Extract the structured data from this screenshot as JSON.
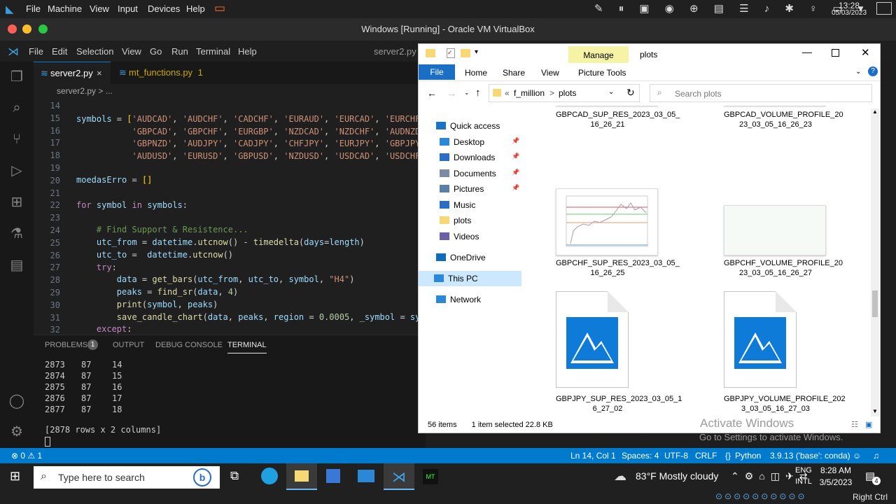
{
  "host": {
    "menu": [
      "File",
      "Machine",
      "View",
      "Input",
      "Devices",
      "Help"
    ],
    "time": "13:28",
    "date": "05/03/2023",
    "title": "Windows [Running] - Oracle VM VirtualBox",
    "right_ctrl": "Right Ctrl"
  },
  "vscode": {
    "menu": [
      "File",
      "Edit",
      "Selection",
      "View",
      "Go",
      "Run",
      "Terminal",
      "Help"
    ],
    "window_title": "server2.py -",
    "tabs": [
      {
        "label": "server2.py",
        "active": true,
        "close": "×"
      },
      {
        "label": "mt_functions.py",
        "badge": "1",
        "active": false
      }
    ],
    "breadcrumb": "server2.py > ...",
    "line_numbers": [
      "14",
      "15",
      "16",
      "17",
      "18",
      "19",
      "20",
      "21",
      "22",
      "23",
      "24",
      "25",
      "26",
      "27",
      "28",
      "29",
      "30",
      "31",
      "32"
    ],
    "panel_tabs": [
      "PROBLEMS",
      "OUTPUT",
      "DEBUG CONSOLE",
      "TERMINAL"
    ],
    "problems_badge": "1",
    "terminal_rows": [
      [
        "2873",
        "87",
        "14"
      ],
      [
        "2874",
        "87",
        "15"
      ],
      [
        "2875",
        "87",
        "16"
      ],
      [
        "2876",
        "87",
        "17"
      ],
      [
        "2877",
        "87",
        "18"
      ]
    ],
    "terminal_summary": "[2878 rows x 2 columns]",
    "status": {
      "errors": "⊗ 0 ⚠ 1",
      "position": "Ln 14, Col 1",
      "spaces": "Spaces: 4",
      "encoding": "UTF-8",
      "eol": "CRLF",
      "language": "Python",
      "interpreter": "3.9.13 ('base': conda)"
    }
  },
  "explorer": {
    "title": "plots",
    "manage": "Manage",
    "ribbon": [
      "File",
      "Home",
      "Share",
      "View",
      "Picture Tools"
    ],
    "address": [
      "«",
      "f_million",
      ">",
      "plots"
    ],
    "search_placeholder": "Search plots",
    "nav": [
      {
        "label": "Quick access",
        "icon": "star-icon",
        "color": "#1a73c7"
      },
      {
        "label": "Desktop",
        "icon": "desktop-icon",
        "color": "#2b88d8",
        "pinned": true
      },
      {
        "label": "Downloads",
        "icon": "download-icon",
        "color": "#2b6cc4",
        "pinned": true
      },
      {
        "label": "Documents",
        "icon": "document-icon",
        "color": "#7a8ba3",
        "pinned": true
      },
      {
        "label": "Pictures",
        "icon": "pictures-icon",
        "color": "#5b7fa6",
        "pinned": true
      },
      {
        "label": "Music",
        "icon": "music-icon",
        "color": "#2b6cc4"
      },
      {
        "label": "plots",
        "icon": "folder-icon",
        "color": "#f8d775"
      },
      {
        "label": "Videos",
        "icon": "videos-icon",
        "color": "#6b5fa8"
      },
      {
        "label": "OneDrive",
        "icon": "cloud-icon",
        "color": "#0f6cbd"
      },
      {
        "label": "This PC",
        "icon": "pc-icon",
        "color": "#2b88d8",
        "selected": true
      },
      {
        "label": "Network",
        "icon": "network-icon",
        "color": "#2b88d8"
      }
    ],
    "files": [
      {
        "name": "GBPCAD_SUP_RES_2023_03_05_\n16_26_21",
        "kind": "chart-partial"
      },
      {
        "name": "GBPCAD_VOLUME_PROFILE_20\n23_03_05_16_26_23",
        "kind": "blank-partial"
      },
      {
        "name": "GBPCHF_SUP_RES_2023_03_05_\n16_26_25",
        "kind": "chart"
      },
      {
        "name": "GBPCHF_VOLUME_PROFILE_20\n23_03_05_16_26_27",
        "kind": "blank"
      },
      {
        "name": "GBPJPY_SUP_RES_2023_03_05_1\n6_27_02",
        "kind": "doc"
      },
      {
        "name": "GBPJPY_VOLUME_PROFILE_202\n3_03_05_16_27_03",
        "kind": "doc"
      }
    ],
    "status_items": "56 items",
    "status_selected": "1 item selected  22.8 KB"
  },
  "watermark": {
    "title": "Activate Windows",
    "subtitle": "Go to Settings to activate Windows."
  },
  "taskbar": {
    "search_placeholder": "Type here to search",
    "weather": "83°F  Mostly cloudy",
    "lang1": "ENG",
    "lang2": "INTL",
    "time": "8:28 AM",
    "date": "3/5/2023",
    "notif": "4"
  }
}
